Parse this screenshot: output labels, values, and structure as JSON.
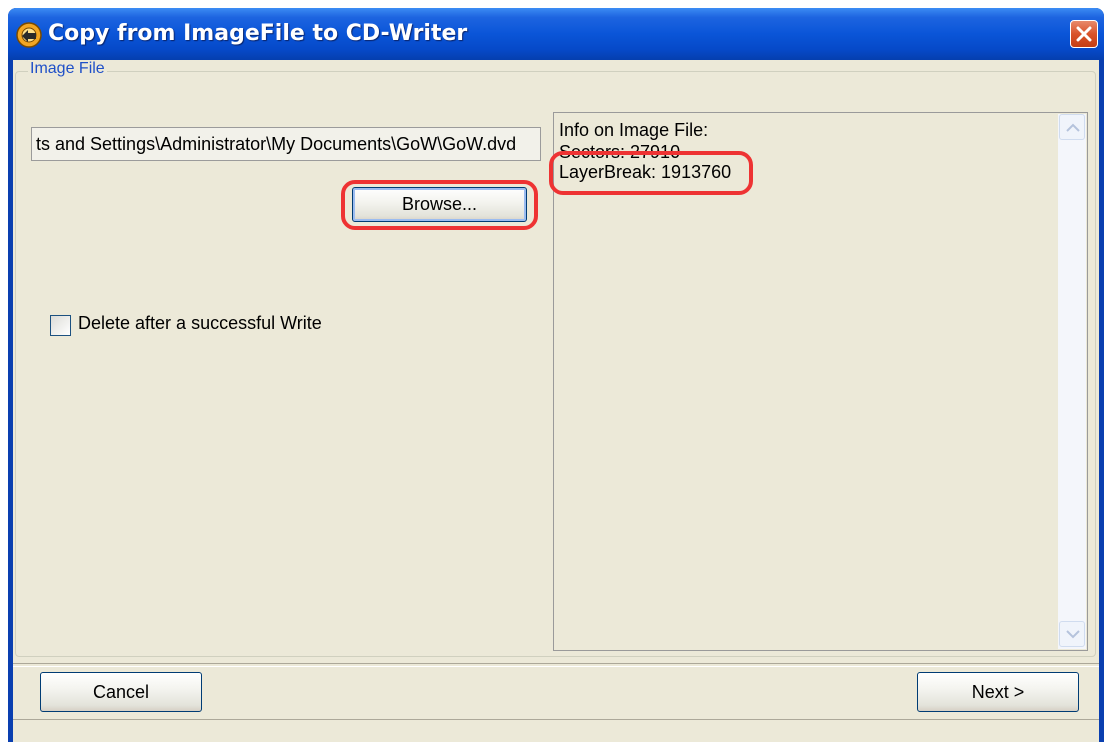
{
  "window": {
    "title": "Copy from ImageFile to CD-Writer",
    "icon": "disc-copy-icon",
    "close_icon": "close-icon"
  },
  "image_file_group": {
    "legend": "Image File",
    "path_value": "ts and Settings\\Administrator\\My Documents\\GoW\\GoW.dvd",
    "browse_label": "Browse...",
    "delete_checkbox_label": "Delete after a successful Write",
    "delete_checked": false
  },
  "info_panel": {
    "heading": "Info on Image File:",
    "sectors_line": "Sectors: 27910",
    "layerbreak_line": "LayerBreak: 1913760"
  },
  "footer": {
    "cancel_label": "Cancel",
    "next_label": "Next >"
  },
  "colors": {
    "titlebar": "#0a55d8",
    "annotation": "#ee3333",
    "dialog_bg": "#ece9d8"
  }
}
